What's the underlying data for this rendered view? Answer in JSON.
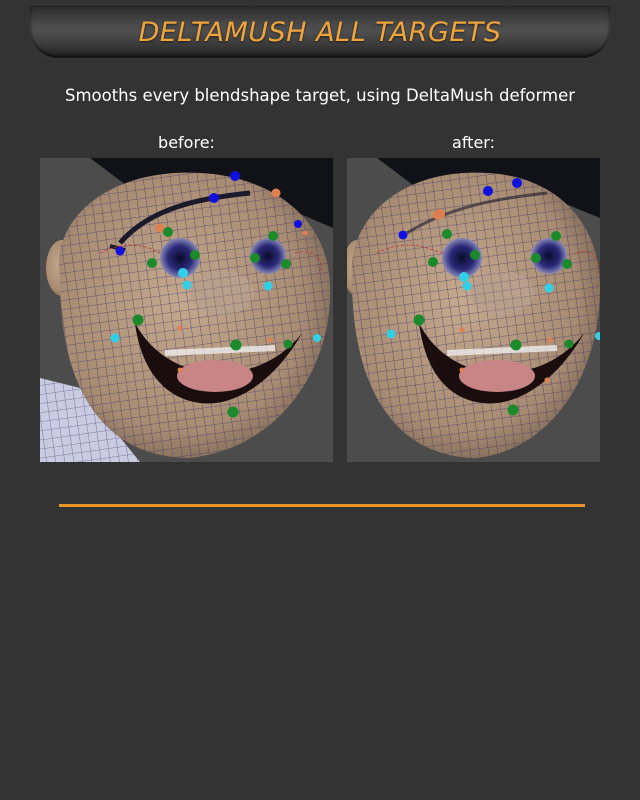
{
  "header": {
    "title": "DELTAMUSH ALL TARGETS"
  },
  "description": "Smooths every blendshape target, using DeltaMush deformer",
  "comparison": {
    "before_label": "before:",
    "after_label": "after:"
  },
  "colors": {
    "accent": "#e8952a",
    "background": "#333333",
    "skin": "#b59a80",
    "wire": "#3a2f6e"
  }
}
